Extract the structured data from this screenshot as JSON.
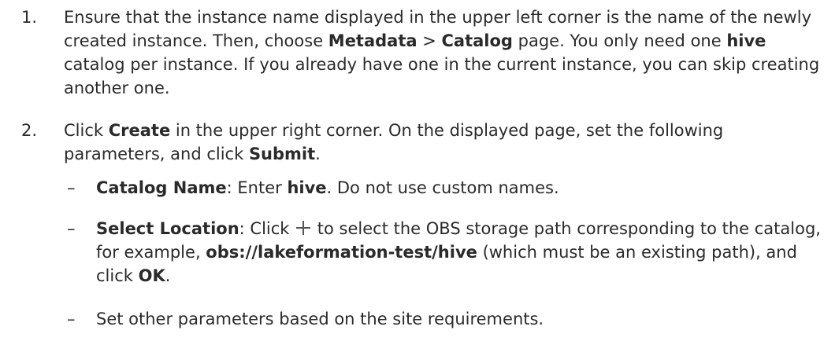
{
  "steps": [
    {
      "number": "1.",
      "t1": "Ensure that the instance name displayed in the upper left corner is the name of the newly created instance. Then, choose ",
      "b1": "Metadata",
      "t2": " > ",
      "b2": "Catalog",
      "t3": " page. You only need one ",
      "b3": "hive",
      "t4": " catalog per instance. If you already have one in the current instance, you can skip creating another one."
    },
    {
      "number": "2.",
      "t1": "Click ",
      "b1": "Create",
      "t2": " in the upper right corner. On the displayed page, set the following parameters, and click ",
      "b2": "Submit",
      "t3": "."
    }
  ],
  "sub_items": [
    {
      "bullet": "–",
      "b1": "Catalog Name",
      "t1": ": Enter ",
      "b2": "hive",
      "t2": ". Do not use custom names."
    },
    {
      "bullet": "–",
      "b1": "Select Location",
      "t1": ": Click ",
      "icon": "plus-icon",
      "t2": " to select the OBS storage path corresponding to the catalog, for example, ",
      "b2": "obs://lakeformation-test/hive",
      "t3": " (which must be an existing path), and click ",
      "b3": "OK",
      "t4": "."
    },
    {
      "bullet": "–",
      "t1": "Set other parameters based on the site requirements."
    }
  ]
}
